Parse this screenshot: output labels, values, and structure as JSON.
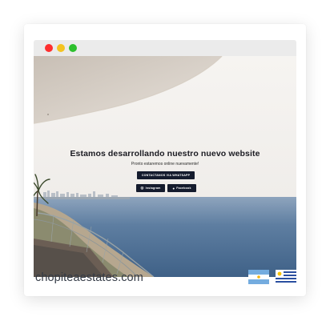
{
  "site": {
    "hero_title": "Estamos desarrollando nuestro nuevo website",
    "hero_subtitle": "Pronto estaremos online nuevamente!",
    "whatsapp_button": "CONTACTANOS VIA WHATSAPP",
    "instagram_button": "Instagram",
    "facebook_button": "Facebook"
  },
  "footer": {
    "domain": "chopiteaestates.com"
  },
  "icons": {
    "instagram": "instagram-icon",
    "facebook": "facebook-icon",
    "window_controls": [
      "close-dot",
      "minimize-dot",
      "maximize-dot"
    ]
  },
  "colors": {
    "button_bg": "#141b2d",
    "sea": "#4f6f93",
    "sky": "#f3f1ee",
    "close_dot": "#fe2f2f",
    "minimize_dot": "#f4c320",
    "maximize_dot": "#2dc02d"
  }
}
